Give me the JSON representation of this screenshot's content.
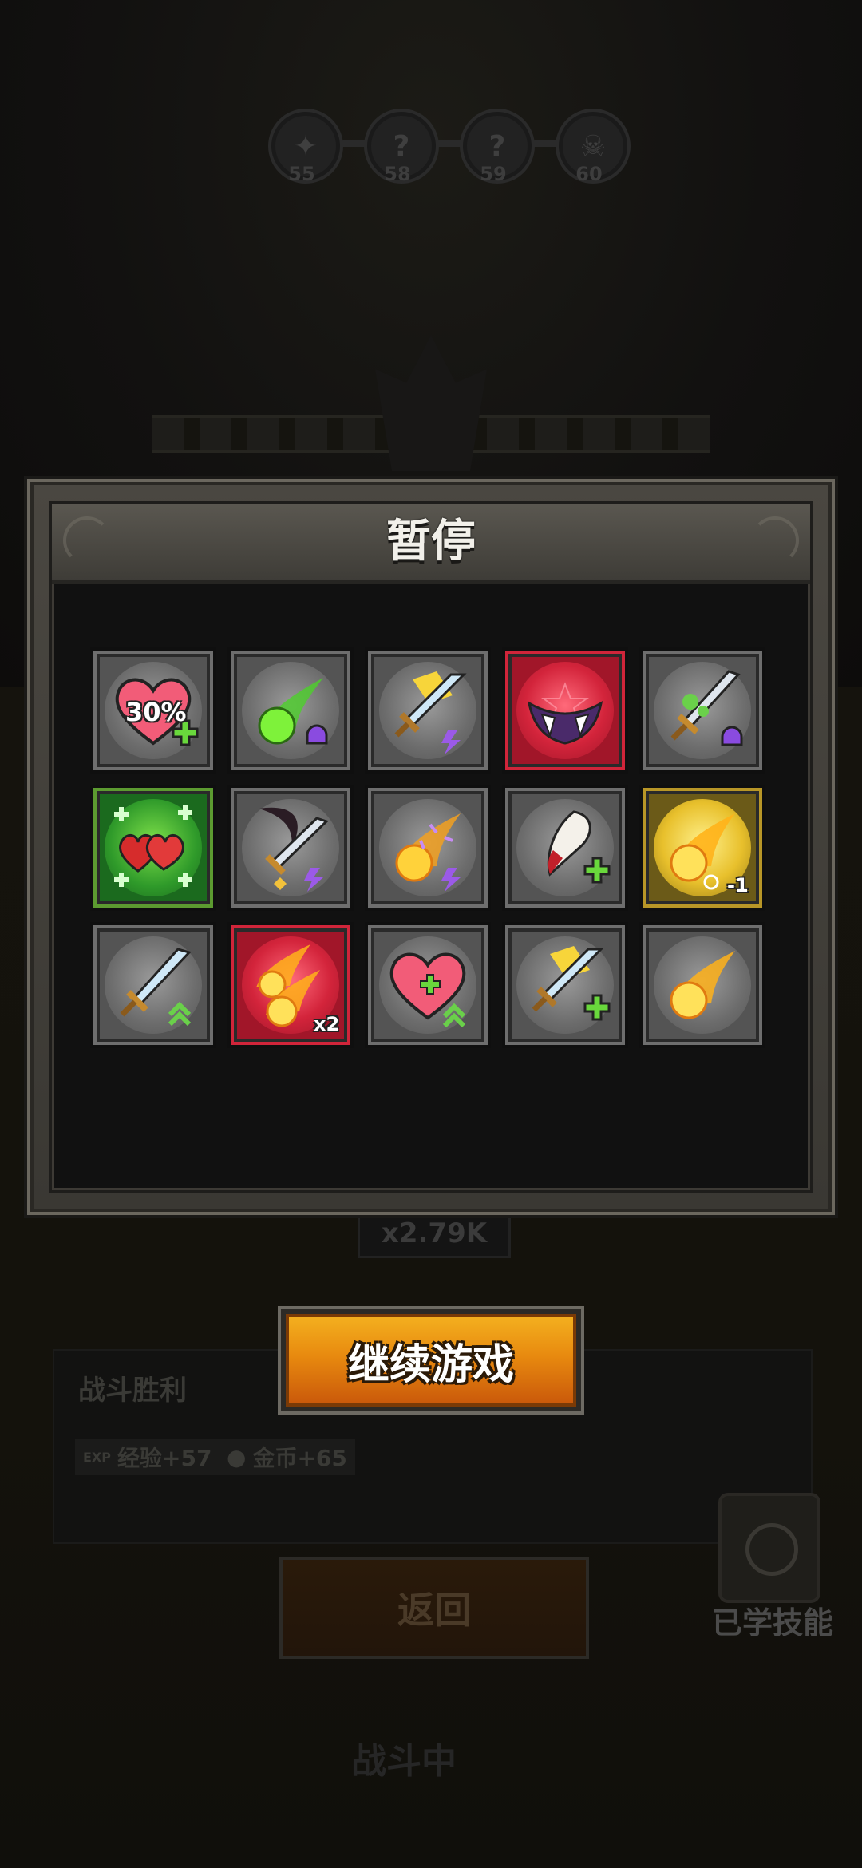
{
  "background": {
    "stages": [
      {
        "number": "55",
        "icon": "leaf-icon"
      },
      {
        "number": "58",
        "icon": "question-icon"
      },
      {
        "number": "59",
        "icon": "question-icon"
      },
      {
        "number": "60",
        "icon": "boss-skull-icon"
      }
    ],
    "multiplier_text": "x2.79K",
    "battle_result": {
      "title": "战斗胜利",
      "exp_label": "经验+57",
      "gold_label": "金币+65"
    },
    "return_label": "返回",
    "learned_skills_label": "已学技能",
    "battle_label": "战斗中"
  },
  "pause_dialog": {
    "title": "暂停",
    "skills": [
      {
        "icon": "heart-plus-icon",
        "frame": "gray",
        "badge": "30%",
        "modifier": "plus"
      },
      {
        "icon": "green-comet-icon",
        "frame": "gray",
        "modifier": "skull"
      },
      {
        "icon": "lightning-sword-icon",
        "frame": "gray",
        "modifier": "lightning"
      },
      {
        "icon": "vampire-fangs-icon",
        "frame": "red",
        "modifier": ""
      },
      {
        "icon": "poison-sword-icon",
        "frame": "gray",
        "modifier": "skull"
      },
      {
        "icon": "healing-hearts-icon",
        "frame": "green",
        "modifier": ""
      },
      {
        "icon": "scythe-sword-icon",
        "frame": "gray",
        "modifier": "lightning"
      },
      {
        "icon": "purple-fireball-icon",
        "frame": "gray",
        "modifier": "lightning"
      },
      {
        "icon": "bloody-claw-icon",
        "frame": "gray",
        "modifier": "plus"
      },
      {
        "icon": "golden-fireball-icon",
        "frame": "gold",
        "badge": "-1",
        "modifier": "timer"
      },
      {
        "icon": "sword-icon",
        "frame": "gray",
        "modifier": "up"
      },
      {
        "icon": "double-fireball-icon",
        "frame": "red",
        "badge": "x2",
        "modifier": ""
      },
      {
        "icon": "heart-icon",
        "frame": "gray",
        "modifier": "up"
      },
      {
        "icon": "golden-sword-icon",
        "frame": "gray",
        "modifier": "plus"
      },
      {
        "icon": "fireball-icon",
        "frame": "gray",
        "modifier": ""
      }
    ]
  },
  "continue_label": "继续游戏"
}
